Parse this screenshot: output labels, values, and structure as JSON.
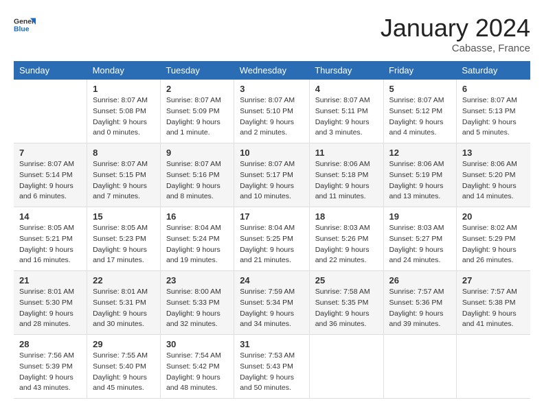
{
  "header": {
    "logo": {
      "general": "General",
      "blue": "Blue"
    },
    "month": "January 2024",
    "location": "Cabasse, France"
  },
  "columns": [
    "Sunday",
    "Monday",
    "Tuesday",
    "Wednesday",
    "Thursday",
    "Friday",
    "Saturday"
  ],
  "weeks": [
    [
      {
        "num": "",
        "info": ""
      },
      {
        "num": "1",
        "info": "Sunrise: 8:07 AM\nSunset: 5:08 PM\nDaylight: 9 hours\nand 0 minutes."
      },
      {
        "num": "2",
        "info": "Sunrise: 8:07 AM\nSunset: 5:09 PM\nDaylight: 9 hours\nand 1 minute."
      },
      {
        "num": "3",
        "info": "Sunrise: 8:07 AM\nSunset: 5:10 PM\nDaylight: 9 hours\nand 2 minutes."
      },
      {
        "num": "4",
        "info": "Sunrise: 8:07 AM\nSunset: 5:11 PM\nDaylight: 9 hours\nand 3 minutes."
      },
      {
        "num": "5",
        "info": "Sunrise: 8:07 AM\nSunset: 5:12 PM\nDaylight: 9 hours\nand 4 minutes."
      },
      {
        "num": "6",
        "info": "Sunrise: 8:07 AM\nSunset: 5:13 PM\nDaylight: 9 hours\nand 5 minutes."
      }
    ],
    [
      {
        "num": "7",
        "info": "Sunrise: 8:07 AM\nSunset: 5:14 PM\nDaylight: 9 hours\nand 6 minutes."
      },
      {
        "num": "8",
        "info": "Sunrise: 8:07 AM\nSunset: 5:15 PM\nDaylight: 9 hours\nand 7 minutes."
      },
      {
        "num": "9",
        "info": "Sunrise: 8:07 AM\nSunset: 5:16 PM\nDaylight: 9 hours\nand 8 minutes."
      },
      {
        "num": "10",
        "info": "Sunrise: 8:07 AM\nSunset: 5:17 PM\nDaylight: 9 hours\nand 10 minutes."
      },
      {
        "num": "11",
        "info": "Sunrise: 8:06 AM\nSunset: 5:18 PM\nDaylight: 9 hours\nand 11 minutes."
      },
      {
        "num": "12",
        "info": "Sunrise: 8:06 AM\nSunset: 5:19 PM\nDaylight: 9 hours\nand 13 minutes."
      },
      {
        "num": "13",
        "info": "Sunrise: 8:06 AM\nSunset: 5:20 PM\nDaylight: 9 hours\nand 14 minutes."
      }
    ],
    [
      {
        "num": "14",
        "info": "Sunrise: 8:05 AM\nSunset: 5:21 PM\nDaylight: 9 hours\nand 16 minutes."
      },
      {
        "num": "15",
        "info": "Sunrise: 8:05 AM\nSunset: 5:23 PM\nDaylight: 9 hours\nand 17 minutes."
      },
      {
        "num": "16",
        "info": "Sunrise: 8:04 AM\nSunset: 5:24 PM\nDaylight: 9 hours\nand 19 minutes."
      },
      {
        "num": "17",
        "info": "Sunrise: 8:04 AM\nSunset: 5:25 PM\nDaylight: 9 hours\nand 21 minutes."
      },
      {
        "num": "18",
        "info": "Sunrise: 8:03 AM\nSunset: 5:26 PM\nDaylight: 9 hours\nand 22 minutes."
      },
      {
        "num": "19",
        "info": "Sunrise: 8:03 AM\nSunset: 5:27 PM\nDaylight: 9 hours\nand 24 minutes."
      },
      {
        "num": "20",
        "info": "Sunrise: 8:02 AM\nSunset: 5:29 PM\nDaylight: 9 hours\nand 26 minutes."
      }
    ],
    [
      {
        "num": "21",
        "info": "Sunrise: 8:01 AM\nSunset: 5:30 PM\nDaylight: 9 hours\nand 28 minutes."
      },
      {
        "num": "22",
        "info": "Sunrise: 8:01 AM\nSunset: 5:31 PM\nDaylight: 9 hours\nand 30 minutes."
      },
      {
        "num": "23",
        "info": "Sunrise: 8:00 AM\nSunset: 5:33 PM\nDaylight: 9 hours\nand 32 minutes."
      },
      {
        "num": "24",
        "info": "Sunrise: 7:59 AM\nSunset: 5:34 PM\nDaylight: 9 hours\nand 34 minutes."
      },
      {
        "num": "25",
        "info": "Sunrise: 7:58 AM\nSunset: 5:35 PM\nDaylight: 9 hours\nand 36 minutes."
      },
      {
        "num": "26",
        "info": "Sunrise: 7:57 AM\nSunset: 5:36 PM\nDaylight: 9 hours\nand 39 minutes."
      },
      {
        "num": "27",
        "info": "Sunrise: 7:57 AM\nSunset: 5:38 PM\nDaylight: 9 hours\nand 41 minutes."
      }
    ],
    [
      {
        "num": "28",
        "info": "Sunrise: 7:56 AM\nSunset: 5:39 PM\nDaylight: 9 hours\nand 43 minutes."
      },
      {
        "num": "29",
        "info": "Sunrise: 7:55 AM\nSunset: 5:40 PM\nDaylight: 9 hours\nand 45 minutes."
      },
      {
        "num": "30",
        "info": "Sunrise: 7:54 AM\nSunset: 5:42 PM\nDaylight: 9 hours\nand 48 minutes."
      },
      {
        "num": "31",
        "info": "Sunrise: 7:53 AM\nSunset: 5:43 PM\nDaylight: 9 hours\nand 50 minutes."
      },
      {
        "num": "",
        "info": ""
      },
      {
        "num": "",
        "info": ""
      },
      {
        "num": "",
        "info": ""
      }
    ]
  ]
}
